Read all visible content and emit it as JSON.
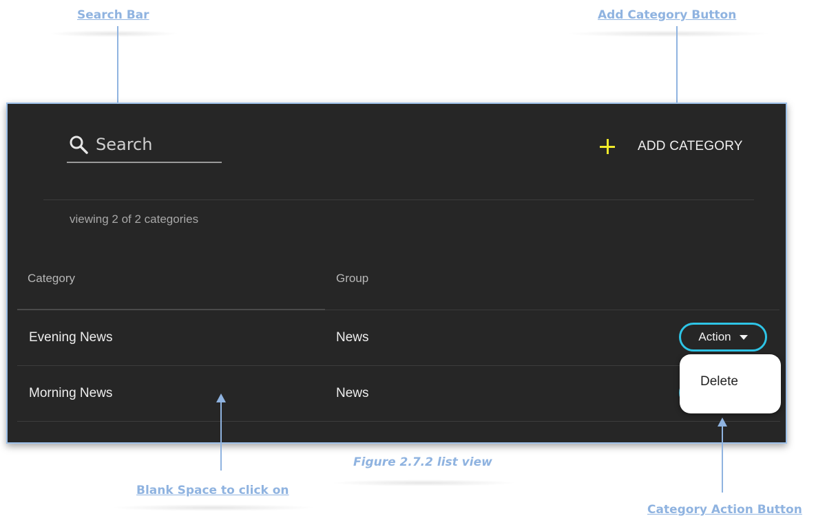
{
  "annotations": {
    "search_bar": "Search Bar",
    "add_category_button": "Add Category Button",
    "blank_space": "Blank Space to click on",
    "category_action_button": "Category Action Button"
  },
  "caption": "Figure 2.7.2 list view",
  "app": {
    "search": {
      "placeholder": "Search",
      "value": ""
    },
    "add_category": {
      "label": "ADD CATEGORY",
      "icon": "plus-icon",
      "icon_color": "#f0ea2a"
    },
    "viewing_text": "viewing 2 of 2 categories",
    "columns": [
      "Category",
      "Group"
    ],
    "rows": [
      {
        "category": "Evening News",
        "group": "News",
        "action_label": "Action"
      },
      {
        "category": "Morning News",
        "group": "News",
        "action_label": "Action"
      }
    ],
    "action_menu": {
      "items": [
        "Delete"
      ]
    },
    "colors": {
      "background": "#262626",
      "accent": "#2ec4e6",
      "annotation": "#8fb3e0"
    }
  }
}
